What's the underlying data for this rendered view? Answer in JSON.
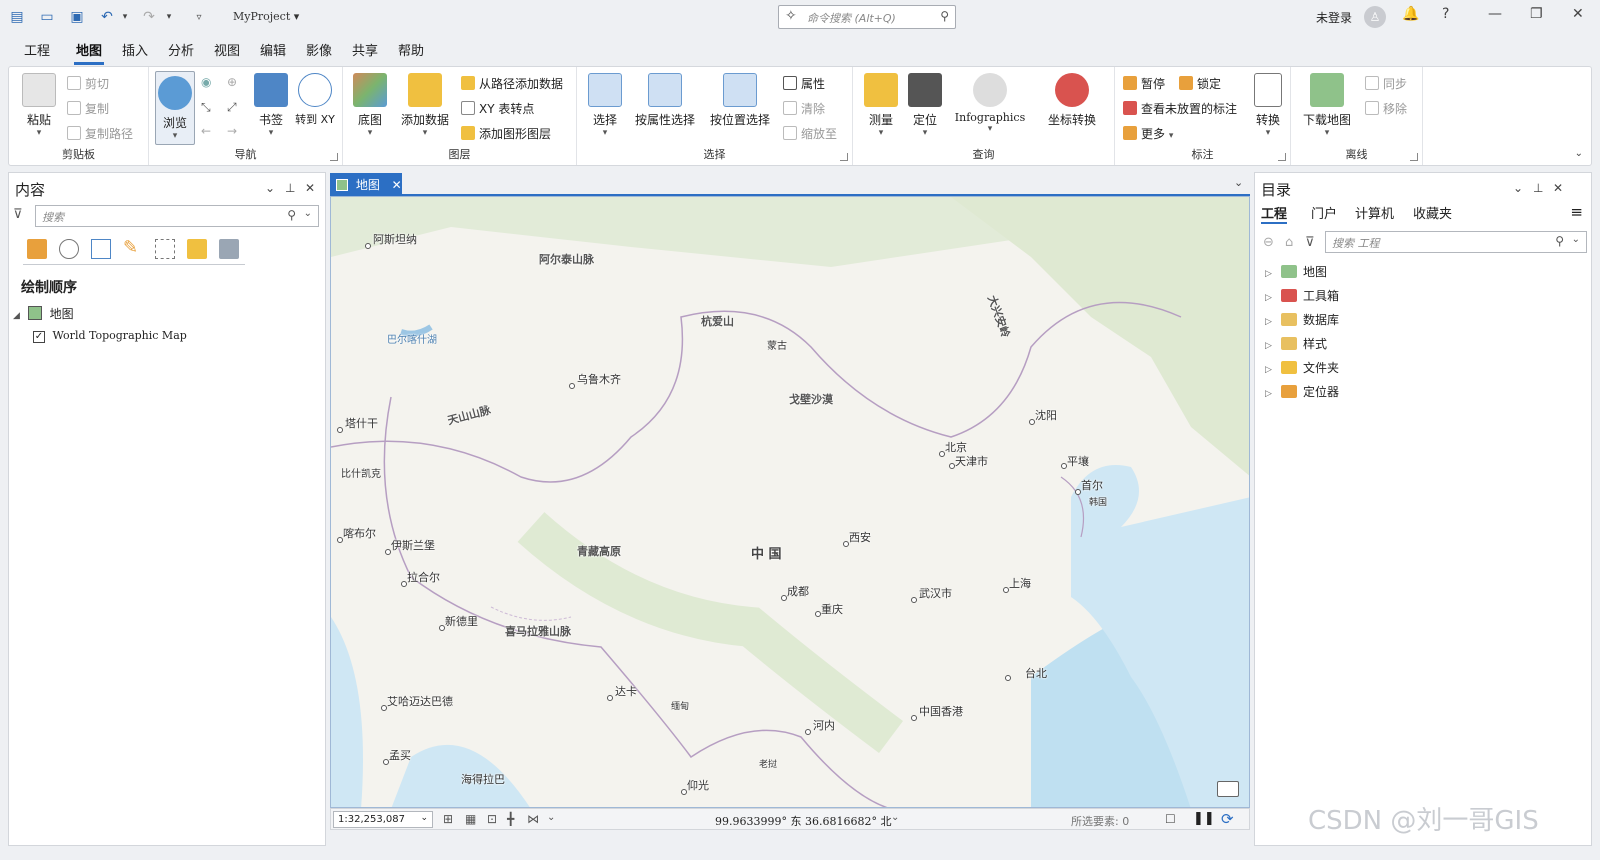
{
  "titlebar": {
    "project": "MyProject ▾",
    "search_placeholder": "命令搜索 (Alt+Q)",
    "user": "未登录"
  },
  "menu": {
    "items": [
      "工程",
      "地图",
      "插入",
      "分析",
      "视图",
      "编辑",
      "影像",
      "共享",
      "帮助"
    ],
    "active": "地图"
  },
  "ribbon": {
    "clipboard": {
      "label": "剪贴板",
      "paste": "粘贴",
      "cut": "剪切",
      "copy": "复制",
      "copy_path": "复制路径"
    },
    "navigate": {
      "label": "导航",
      "explore": "浏览",
      "bookmarks": "书签",
      "goto_xy": "转到 XY"
    },
    "layer": {
      "label": "图层",
      "basemap": "底图",
      "add_data": "添加数据",
      "add_from_path": "从路径添加数据",
      "xy_to_point": "XY 表转点",
      "add_graphics": "添加图形图层"
    },
    "selection": {
      "label": "选择",
      "select": "选择",
      "by_attr": "按属性选择",
      "by_loc": "按位置选择",
      "attributes": "属性",
      "clear": "清除",
      "zoom_to": "缩放至"
    },
    "inquiry": {
      "label": "查询",
      "measure": "测量",
      "locate": "定位",
      "infographics": "Infographics",
      "coord_convert": "坐标转换"
    },
    "labeling": {
      "label": "标注",
      "pause": "暂停",
      "lock": "锁定",
      "view_unplaced": "查看未放置的标注",
      "more": "更多",
      "convert": "转换"
    },
    "offline": {
      "label": "离线",
      "download_map": "下载地图",
      "sync": "同步",
      "remove": "移除"
    }
  },
  "contents": {
    "title": "内容",
    "search_placeholder": "搜索",
    "draw_order": "绘制顺序",
    "map": "地图",
    "layer": "World Topographic Map"
  },
  "map": {
    "tab": "地图",
    "labels": [
      "阿斯坦纳",
      "阿尔泰山脉",
      "杭爱山",
      "蒙古",
      "乌鲁木齐",
      "戈壁沙漠",
      "天山山脉",
      "塔什干",
      "比什凯克",
      "伊斯兰堡",
      "喀布尔",
      "拉合尔",
      "青藏高原",
      "中 国",
      "西安",
      "北京",
      "天津市",
      "沈阳",
      "平壤",
      "首尔",
      "韩国",
      "成都",
      "重庆",
      "武汉市",
      "上海",
      "新德里",
      "喜马拉雅山脉",
      "达卡",
      "缅甸",
      "河内",
      "台北",
      "中国香港",
      "艾哈迈达巴德",
      "孟买",
      "海得拉巴",
      "仰光",
      "老挝",
      "大兴安岭",
      "巴尔喀什湖"
    ],
    "scale": "1:32,253,087",
    "coords": "99.9633999° 东  36.6816682° 北",
    "selected": "所选要素: 0"
  },
  "catalog": {
    "title": "目录",
    "tabs": [
      "工程",
      "门户",
      "计算机",
      "收藏夹"
    ],
    "search_placeholder": "搜索 工程",
    "items": [
      "地图",
      "工具箱",
      "数据库",
      "样式",
      "文件夹",
      "定位器"
    ]
  },
  "watermark": "CSDN @刘一哥GIS"
}
